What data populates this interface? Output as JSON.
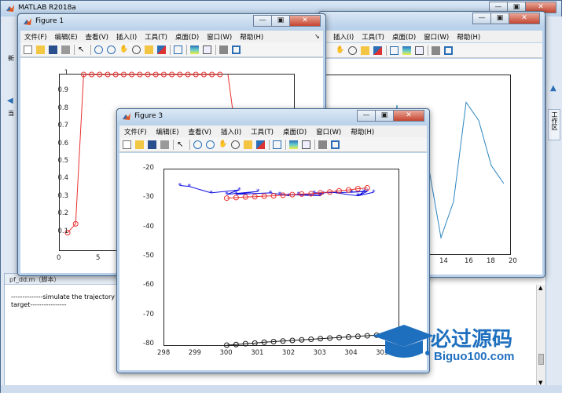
{
  "matlab": {
    "title": "MATLAB R2018a",
    "side_tab": "工作区",
    "file_tab": "pf_dd.m（脚本）",
    "tab_left_fragment": "新",
    "addr_left_fragment": "当",
    "command_lines": [
      "--------------simulate the trajectory",
      "target----------------"
    ]
  },
  "windows": {
    "min_label": "▭",
    "max_label": "▣",
    "close_label": "✕"
  },
  "figure1": {
    "title": "Figure 1",
    "menus": [
      "文件(F)",
      "编辑(E)",
      "查看(V)",
      "插入(I)",
      "工具(T)",
      "桌面(D)",
      "窗口(W)",
      "帮助(H)"
    ],
    "yticks": [
      "1",
      "0.9",
      "0.8",
      "0.7",
      "0.6",
      "0.5",
      "0.4",
      "0.3",
      "0.2",
      "0.1"
    ],
    "xticks": [
      "0",
      "5"
    ]
  },
  "figure2": {
    "menus": [
      "插入(I)",
      "工具(T)",
      "桌面(D)",
      "窗口(W)",
      "帮助(H)"
    ],
    "xticks": [
      "14",
      "16",
      "18",
      "20"
    ]
  },
  "figure3": {
    "title": "Figure 3",
    "menus": [
      "文件(F)",
      "编辑(E)",
      "查看(V)",
      "插入(I)",
      "工具(T)",
      "桌面(D)",
      "窗口(W)",
      "帮助(H)"
    ],
    "yticks": [
      "-20",
      "-30",
      "-40",
      "-50",
      "-60",
      "-70",
      "-80"
    ],
    "xticks": [
      "298",
      "299",
      "300",
      "301",
      "302",
      "303",
      "304",
      "305"
    ]
  },
  "watermark": {
    "cn": "必过源码",
    "en": "Biguo100.com"
  },
  "chart_data": [
    {
      "type": "line",
      "figure": "Figure 1",
      "xlim": [
        0,
        10
      ],
      "ylim": [
        0,
        1
      ],
      "series": [
        {
          "color": "#e8322f",
          "marker": "circle",
          "x": [
            1,
            2,
            3,
            4,
            5,
            6,
            7,
            8,
            9,
            10,
            11,
            12,
            13,
            14,
            15,
            16,
            17,
            18,
            19,
            20,
            21
          ],
          "y": [
            0.1,
            0.15,
            1,
            1,
            1,
            1,
            1,
            1,
            1,
            1,
            1,
            1,
            1,
            1,
            1,
            1,
            1,
            1,
            1,
            1,
            1
          ]
        }
      ]
    },
    {
      "type": "line",
      "figure": "Figure 2",
      "xlim": [
        0,
        20
      ],
      "series": [
        {
          "color": "#2e86c1",
          "x": [
            13,
            14,
            15,
            16,
            17,
            18,
            19
          ],
          "y": [
            0.5,
            0.1,
            0.3,
            0.85,
            0.75,
            0.5,
            0.4
          ]
        }
      ]
    },
    {
      "type": "line",
      "figure": "Figure 3",
      "xlim": [
        298,
        305.5
      ],
      "ylim": [
        -80,
        -20
      ],
      "series": [
        {
          "color": "#1010e0",
          "marker": "star",
          "x": [
            298.5,
            298.8,
            299.5,
            300.4,
            300.0,
            301.0,
            300.3,
            301.4,
            302.0,
            301.7,
            303.0,
            302.3,
            303.1,
            302.8,
            304.0,
            304.5,
            304.2,
            303.5,
            304.4,
            304.2,
            304.7
          ],
          "y": [
            -25.5,
            -25.8,
            -28.0,
            -27.0,
            -28.5,
            -27.5,
            -28.5,
            -28.0,
            -29.0,
            -28.5,
            -29.0,
            -28.5,
            -28.3,
            -28.0,
            -27.8,
            -27.5,
            -29.0,
            -28.0,
            -27.5,
            -29.0,
            -27.8
          ]
        },
        {
          "color": "#e8322f",
          "marker": "circle",
          "x": [
            300.0,
            300.3,
            300.6,
            300.9,
            301.2,
            301.5,
            301.8,
            302.1,
            302.4,
            302.7,
            303.0,
            303.3,
            303.6,
            303.9,
            304.2,
            304.5
          ],
          "y": [
            -29.8,
            -29.6,
            -29.4,
            -29.3,
            -29.1,
            -29.0,
            -28.8,
            -28.6,
            -28.4,
            -28.3,
            -28.0,
            -27.7,
            -27.3,
            -27.0,
            -26.6,
            -26.3
          ]
        },
        {
          "color": "#1a1a1a",
          "marker": "circle",
          "x": [
            300.0,
            300.3,
            300.6,
            300.9,
            301.2,
            301.5,
            301.8,
            302.1,
            302.4,
            302.7,
            303.0,
            303.3,
            303.6,
            303.9,
            304.2,
            304.5,
            304.8,
            305.1,
            305.3
          ],
          "y": [
            -80.0,
            -79.8,
            -79.5,
            -79.3,
            -79.0,
            -78.8,
            -78.6,
            -78.4,
            -78.2,
            -78.0,
            -77.8,
            -77.6,
            -77.4,
            -77.2,
            -77.0,
            -76.8,
            -76.6,
            -76.4,
            -76.2
          ]
        }
      ]
    }
  ]
}
